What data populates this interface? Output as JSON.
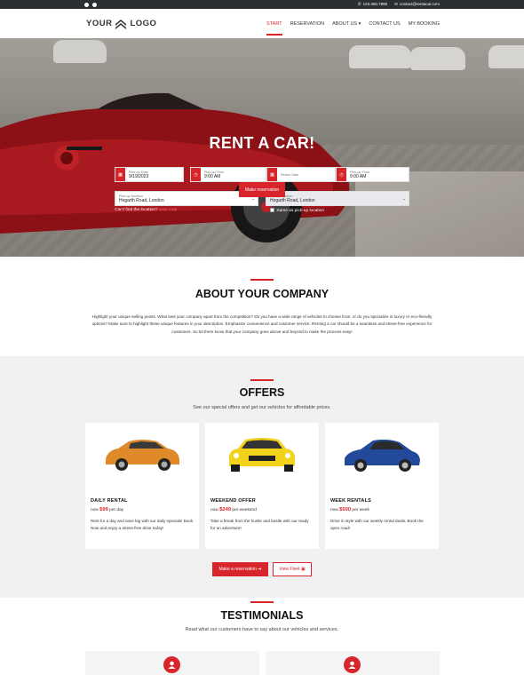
{
  "topbar": {
    "social": [
      "facebook-icon",
      "twitter-icon"
    ],
    "phone": "123.456.7890",
    "email": "contact@rentacar.com"
  },
  "header": {
    "logo_left": "YOUR",
    "logo_right": "LOGO",
    "nav": [
      "START",
      "RESERVATION",
      "ABOUT US",
      "CONTACT US",
      "MY BOOKING"
    ],
    "active": "START"
  },
  "hero": {
    "title": "RENT A CAR!",
    "pickup_date_label": "Pick-up Date",
    "pickup_date": "9/19/2023",
    "pickup_time_label": "Pick-up Time",
    "pickup_time": "9:00 AM",
    "return_date_label": "Return Date",
    "return_date": "",
    "return_time_label": "Pick-up Time",
    "return_time": "9:00 AM",
    "pickup_location_label": "Pick-up location",
    "pickup_location": "Hogarth Road, London",
    "return_location_label": "Return location",
    "return_location": "Hogarth Road, London",
    "cant_find": "Can't find the location?",
    "cant_find_link": "view map",
    "same_as": "Same as pick-up location",
    "button": "Make reservation"
  },
  "about": {
    "title": "ABOUT YOUR COMPANY",
    "text": "Highlight your unique selling points. What sets your company apart from the competition? Do you have a wide range of vehicles to choose from, or do you specialize in luxury or eco-friendly options? Make sure to highlight these unique features in your description. Emphasize convenience and customer service. Renting a car should be a seamless and stress-free experience for customers. So let them know that your company goes above and beyond to make the process easy!"
  },
  "offers": {
    "title": "OFFERS",
    "subtitle": "See our special offers and get our vehicles for affordable prices.",
    "cards": [
      {
        "name": "DAILY RENTAL",
        "prefix": "now",
        "price": "$99",
        "unit": "per day",
        "desc": "Rent for a day and save big with our daily specials! Book Now and enjoy a stress-free drive today!",
        "color": "#e0892a"
      },
      {
        "name": "WEEKEND OFFER",
        "prefix": "now",
        "price": "$249",
        "unit": "per weekend",
        "desc": "Take a break from the hustle and bustle with our ready for an adventure!",
        "color": "#f3d21b"
      },
      {
        "name": "WEEK RENTALS",
        "prefix": "now",
        "price": "$500",
        "unit": "per week",
        "desc": "Drive in style with our weekly rental deals. Book the open road!",
        "color": "#234a9a"
      }
    ],
    "btn_reserve": "Make a reservation",
    "btn_fleet": "View Fleet"
  },
  "testimonials": {
    "title": "TESTIMONIALS",
    "subtitle": "Read what our customers have to say about our vehicles and services."
  },
  "colors": {
    "accent": "#d7252b",
    "dark": "#2b2f33"
  }
}
